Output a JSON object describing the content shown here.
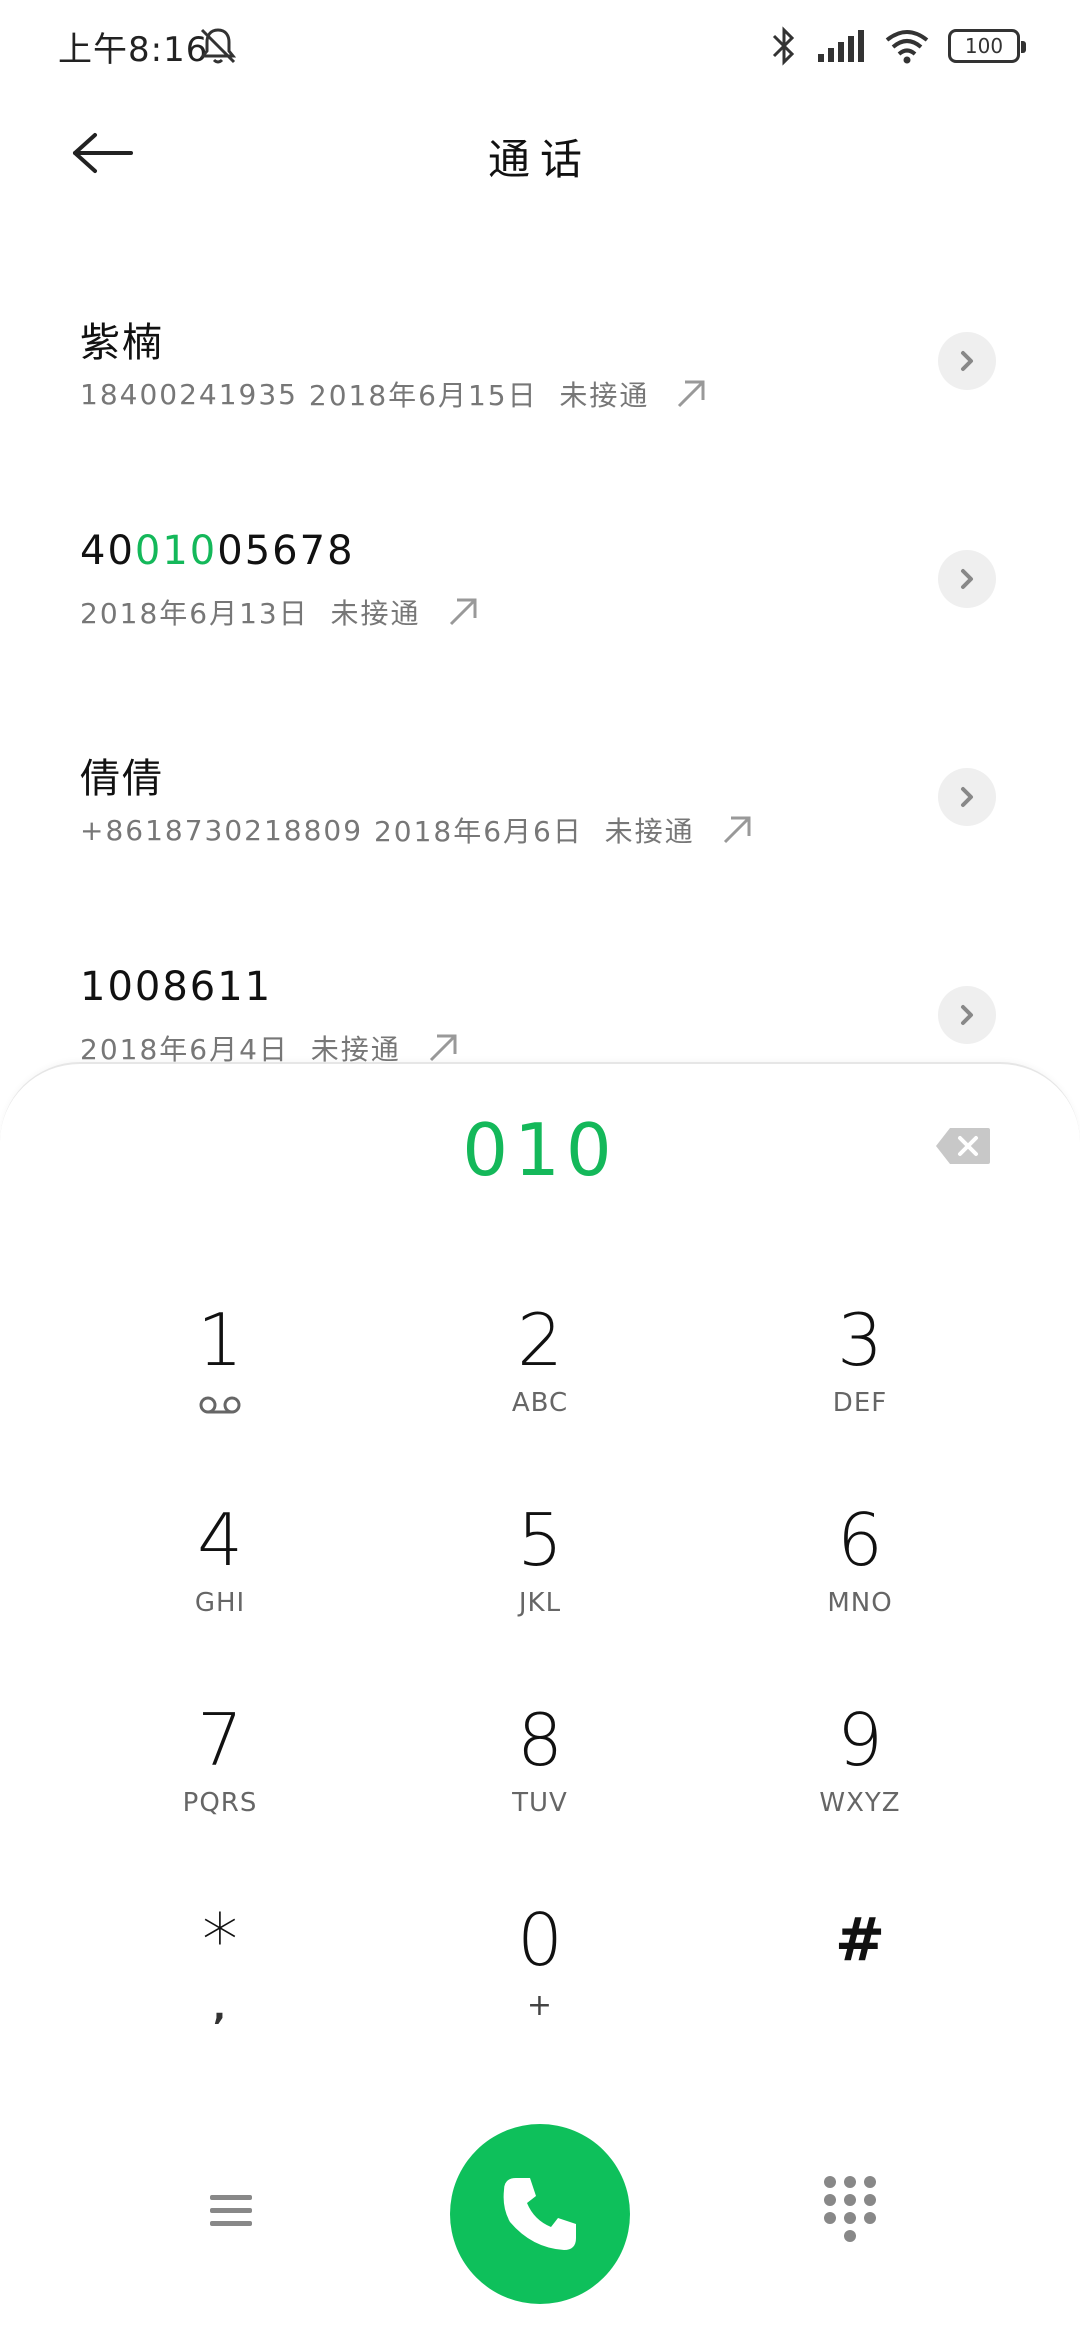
{
  "status_bar": {
    "time": "上午8:16",
    "battery": "100",
    "icons": [
      "bell-off-icon",
      "bluetooth-icon",
      "signal-icon",
      "wifi-icon",
      "battery-icon"
    ]
  },
  "header": {
    "title": "通话"
  },
  "calls": [
    {
      "name": "紫楠",
      "name_pre": "",
      "name_hl": "",
      "name_post": "",
      "number": "18400241935",
      "date": "2018年6月15日",
      "status": "未接通"
    },
    {
      "name": "",
      "name_pre": "40",
      "name_hl": "010",
      "name_post": "05678",
      "number": "",
      "date": "2018年6月13日",
      "status": "未接通"
    },
    {
      "name": "倩倩",
      "name_pre": "",
      "name_hl": "",
      "name_post": "",
      "number": "+8618730218809",
      "date": "2018年6月6日",
      "status": "未接通"
    },
    {
      "name": "1008611",
      "name_pre": "",
      "name_hl": "",
      "name_post": "",
      "number": "",
      "date": "2018年6月4日",
      "status": "未接通"
    }
  ],
  "dialpad": {
    "input": "010",
    "keys": [
      {
        "digit": "1",
        "letters": ""
      },
      {
        "digit": "2",
        "letters": "ABC"
      },
      {
        "digit": "3",
        "letters": "DEF"
      },
      {
        "digit": "4",
        "letters": "GHI"
      },
      {
        "digit": "5",
        "letters": "JKL"
      },
      {
        "digit": "6",
        "letters": "MNO"
      },
      {
        "digit": "7",
        "letters": "PQRS"
      },
      {
        "digit": "8",
        "letters": "TUV"
      },
      {
        "digit": "9",
        "letters": "WXYZ"
      },
      {
        "digit": "*",
        "letters": ","
      },
      {
        "digit": "0",
        "letters": "+"
      },
      {
        "digit": "#",
        "letters": ""
      }
    ]
  },
  "colors": {
    "accent": "#14b85a",
    "call_button": "#0ec05b"
  }
}
